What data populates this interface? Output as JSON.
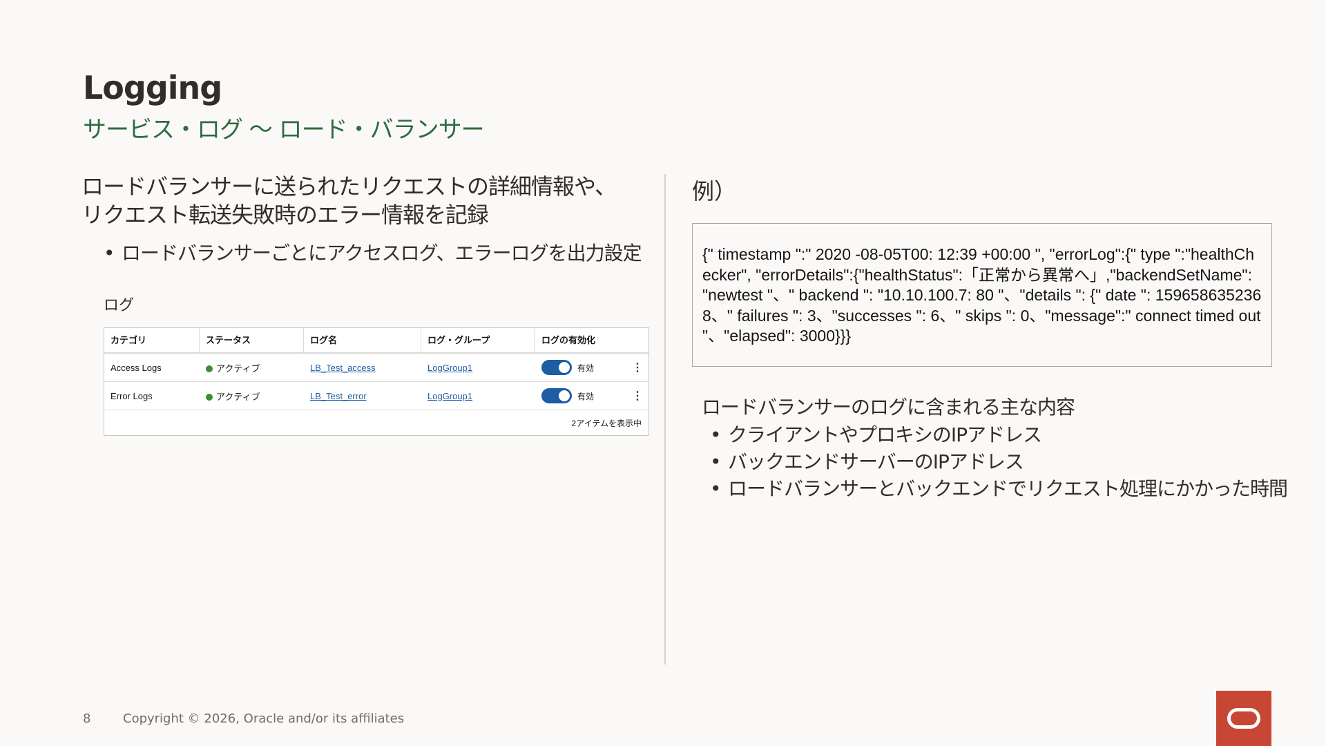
{
  "slide": {
    "title": "Logging",
    "subtitle": "サービス・ログ 〜 ロード・バランサー",
    "left_heading": "ロードバランサーに送られたリクエストの詳細情報や、リクエスト転送失敗時のエラー情報を記録",
    "left_bullet": "ロードバランサーごとにアクセスログ、エラーログを出力設定",
    "log_label": "ログ",
    "example_label": "例）",
    "json_example": "{\" timestamp \":\" 2020 -08-05T00: 12:39 +00:00 \", \"errorLog\":{\" type \":\"healthChecker\", \"errorDetails\":{\"healthStatus\":「正常から異常へ」,\"backendSetName\": \"newtest \"、\" backend \": \"10.10.100.7: 80 \"、\"details \": {\" date \": 1596586352368、\" failures \": 3、\"successes \": 6、\" skips \": 0、\"message\":\" connect timed out \"、\"elapsed\": 3000}}}",
    "right_heading": "ロードバランサーのログに含まれる主な内容",
    "right_items": [
      "クライアントやプロキシのIPアドレス",
      "バックエンドサーバーのIPアドレス",
      "ロードバランサーとバックエンドでリクエスト処理にかかった時間"
    ],
    "bullet_char": "•",
    "page_number": "8",
    "copyright": "Copyright © 2026, Oracle and/or its affiliates"
  },
  "log_table": {
    "headers": [
      "カテゴリ",
      "ステータス",
      "ログ名",
      "ログ・グループ",
      "ログの有効化"
    ],
    "rows": [
      {
        "category": "Access Logs",
        "status": "アクティブ",
        "log_name": "LB_Test_access",
        "log_group": "LogGroup1",
        "enabled_label": "有効",
        "kebab": "⋮"
      },
      {
        "category": "Error Logs",
        "status": "アクティブ",
        "log_name": "LB_Test_error",
        "log_group": "LogGroup1",
        "enabled_label": "有効",
        "kebab": "⋮"
      }
    ],
    "footer": "2アイテムを表示中"
  },
  "colors": {
    "subtitle": "#2e6b3f",
    "status_active": "#3f8a38",
    "toggle_on": "#1c5da3",
    "logo": "#c74634"
  },
  "icons": {
    "status": "green-dot-icon",
    "toggle": "toggle-switch-icon",
    "menu": "kebab-menu-icon",
    "logo": "oracle-logo-icon"
  }
}
